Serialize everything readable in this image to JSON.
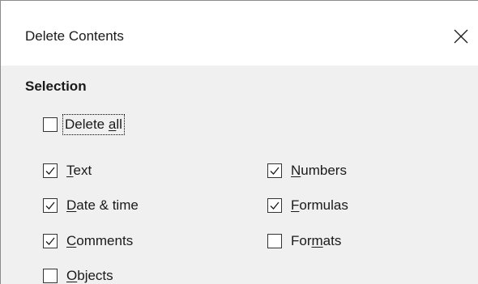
{
  "dialog": {
    "title": "Delete Contents",
    "close_icon": "close-icon"
  },
  "selection": {
    "heading": "Selection",
    "delete_all": {
      "pre": "Delete ",
      "key": "a",
      "post": "ll",
      "checked": false
    },
    "options": [
      {
        "id": "text",
        "pre": "",
        "key": "T",
        "post": "ext",
        "checked": true
      },
      {
        "id": "numbers",
        "pre": "",
        "key": "N",
        "post": "umbers",
        "checked": true
      },
      {
        "id": "date-time",
        "pre": "",
        "key": "D",
        "post": "ate & time",
        "checked": true
      },
      {
        "id": "formulas",
        "pre": "",
        "key": "F",
        "post": "ormulas",
        "checked": true
      },
      {
        "id": "comments",
        "pre": "",
        "key": "C",
        "post": "omments",
        "checked": true
      },
      {
        "id": "formats",
        "pre": "For",
        "key": "m",
        "post": "ats",
        "checked": false
      },
      {
        "id": "objects",
        "pre": "",
        "key": "O",
        "post": "bjects",
        "checked": false
      }
    ]
  },
  "colors": {
    "dialog_bg": "#f0f0f0",
    "titlebar_bg": "#ffffff",
    "text": "#1a1a1a"
  }
}
